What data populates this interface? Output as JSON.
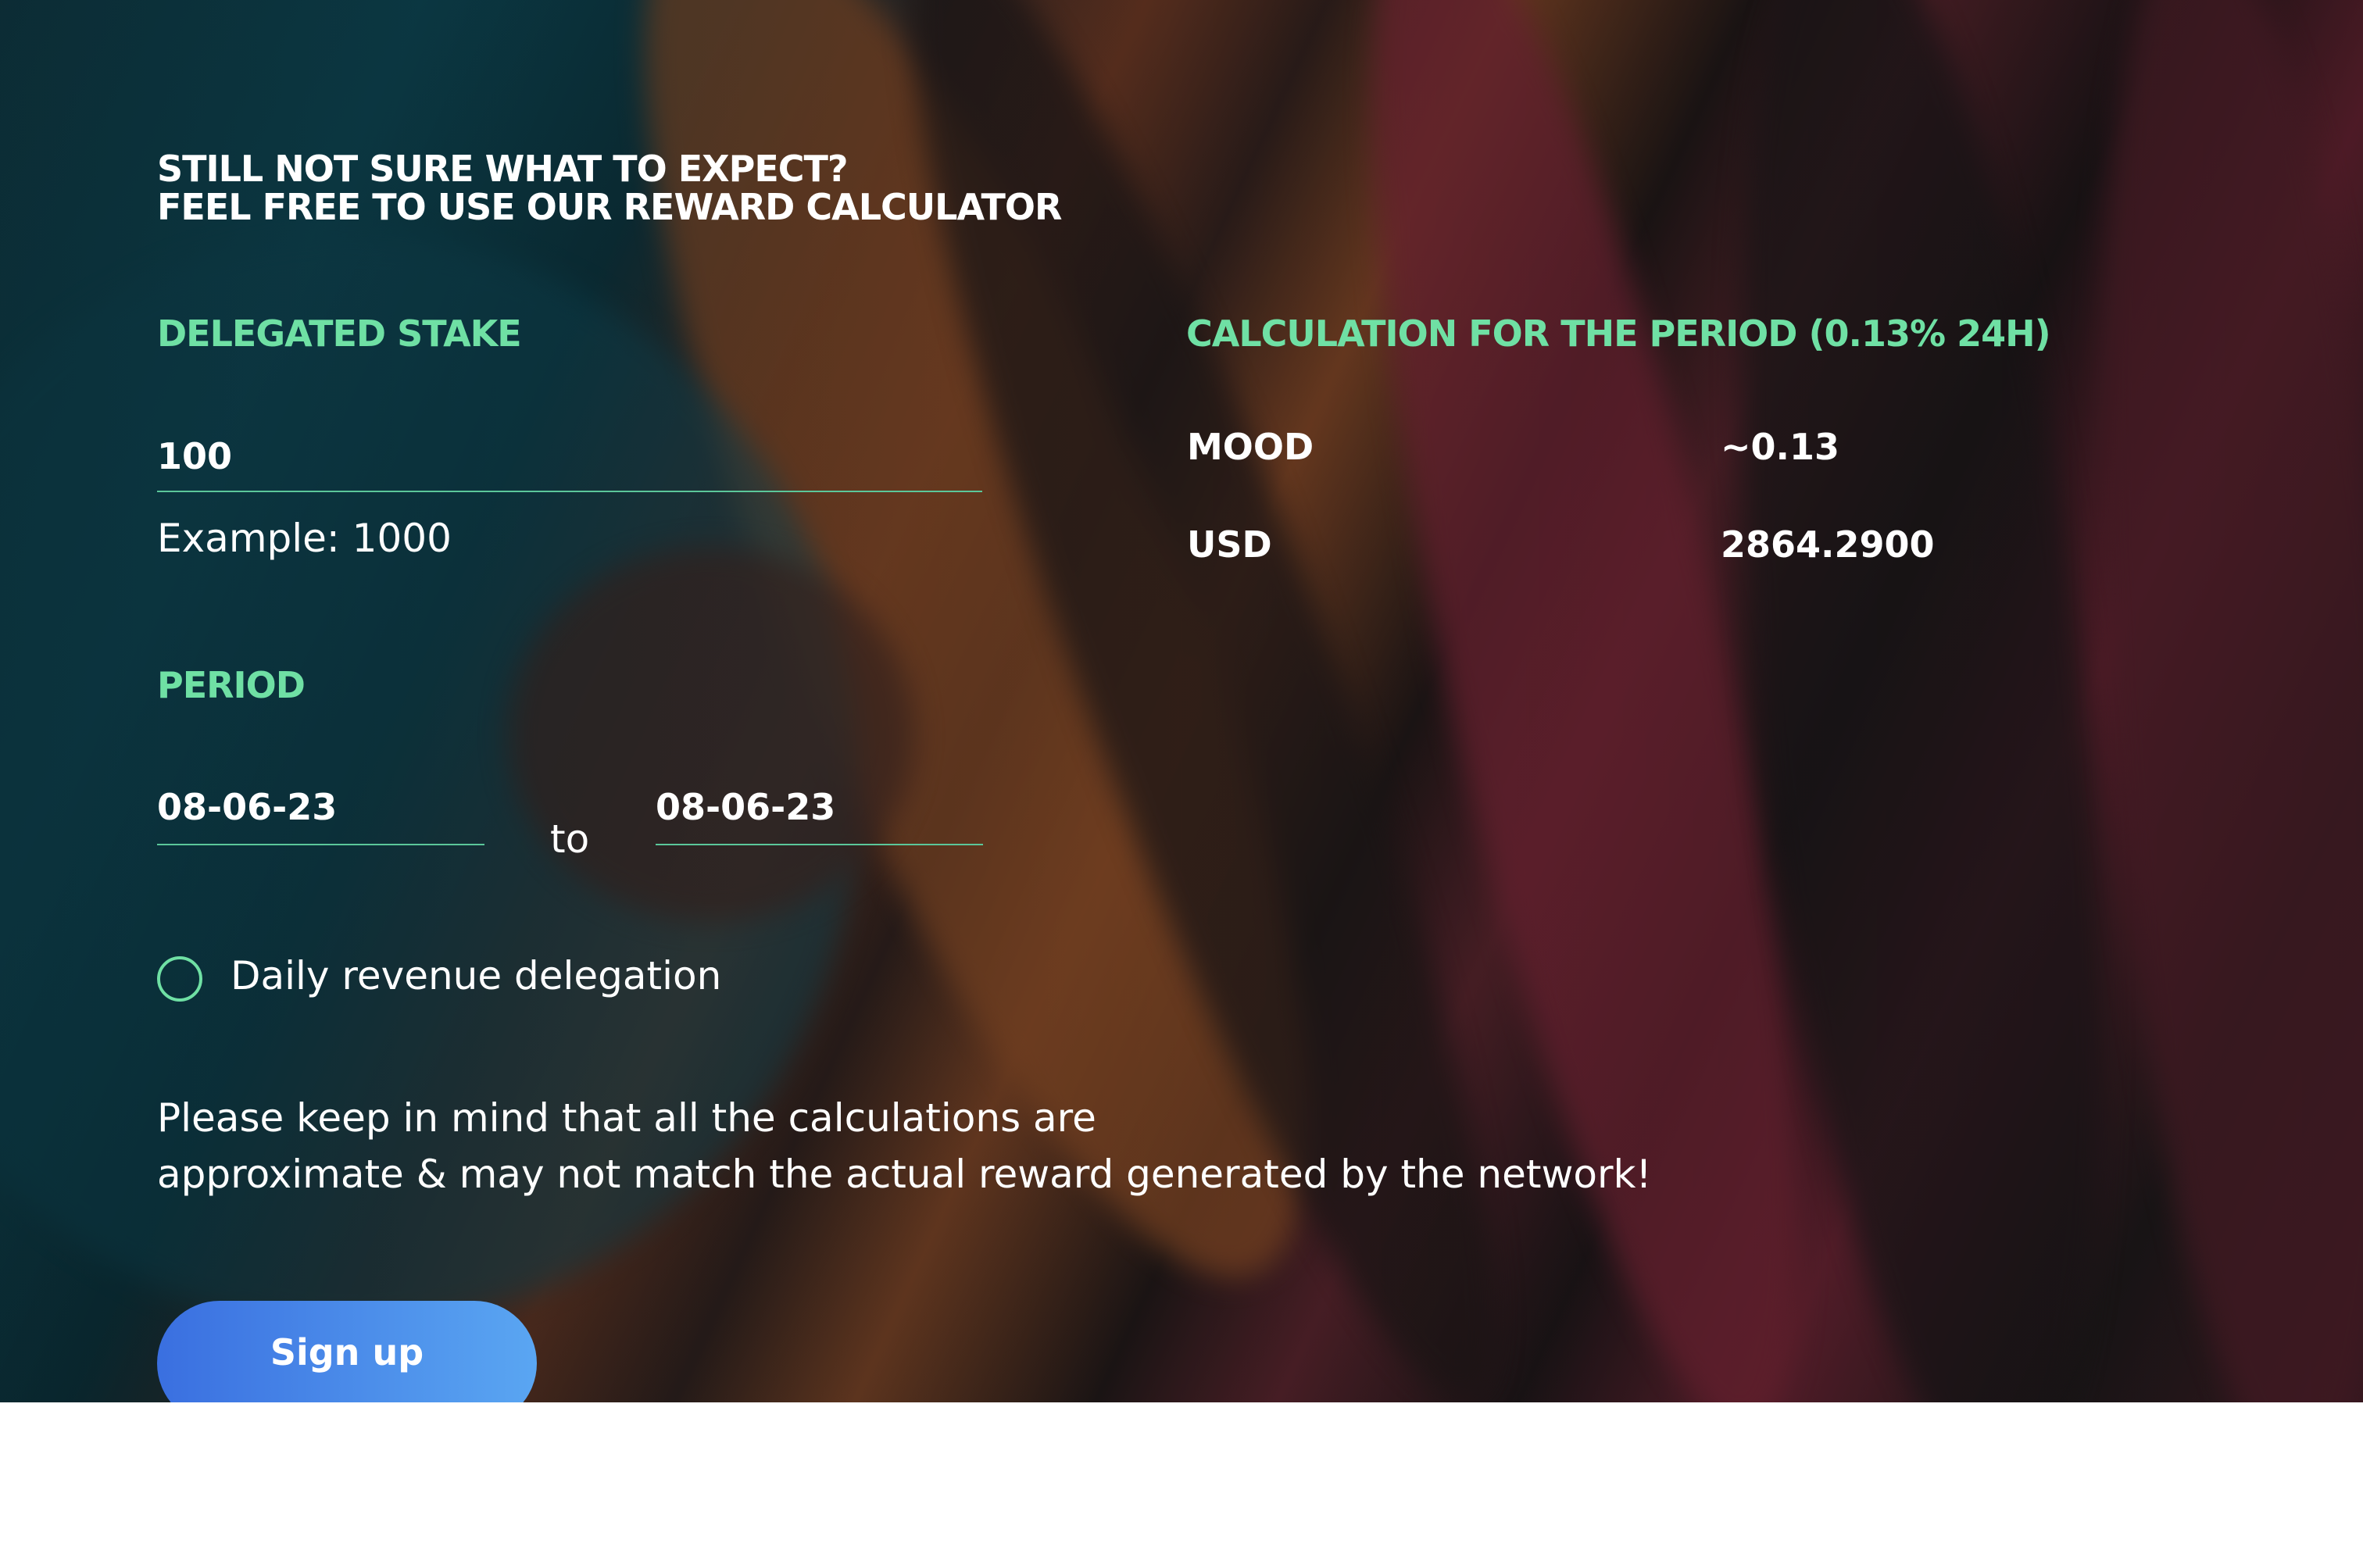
{
  "heading": {
    "line1": "STILL NOT SURE WHAT TO EXPECT?",
    "line2": "FEEL FREE TO USE OUR REWARD CALCULATOR"
  },
  "stake": {
    "label": "DELEGATED STAKE",
    "value": "100",
    "example": "Example: 1000"
  },
  "period": {
    "label": "PERIOD",
    "from": "08-06-23",
    "separator": "to",
    "to": "08-06-23"
  },
  "daily_delegation": {
    "label": "Daily revenue delegation",
    "checked": false
  },
  "note": {
    "line1": "Please keep in mind that all the calculations are",
    "line2": "approximate & may not match the actual reward generated by the network!"
  },
  "signup_label": "Sign up",
  "calculation": {
    "title": "CALCULATION FOR THE PERIOD (0.13% 24H)",
    "rows": [
      {
        "key": "MOOD",
        "value": "~0.13"
      },
      {
        "key": "USD",
        "value": "2864.2900"
      }
    ]
  },
  "colors": {
    "accent_green": "#6fe0a4",
    "button_start": "#3a6fe0",
    "button_end": "#5aa6f2"
  }
}
